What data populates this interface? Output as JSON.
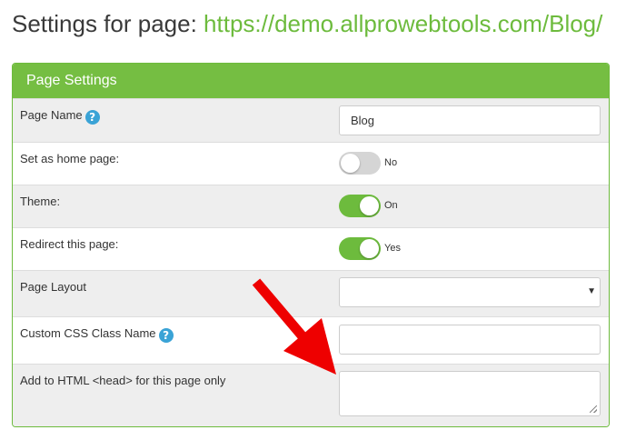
{
  "heading": {
    "prefix": "Settings for page: ",
    "url": "https://demo.allprowebtools.com/Blog/"
  },
  "panel": {
    "title": "Page Settings",
    "rows": [
      {
        "label": "Page Name",
        "value": "Blog"
      },
      {
        "label": "Set as home page:",
        "state": "No"
      },
      {
        "label": "Theme:",
        "state": "On"
      },
      {
        "label": "Redirect this page:",
        "state": "Yes"
      },
      {
        "label": "Page Layout",
        "selected": ""
      },
      {
        "label": "Custom CSS Class Name",
        "value": ""
      },
      {
        "label": "Add to HTML <head> for this page only",
        "value": ""
      }
    ]
  },
  "icons": {
    "help": "question-circle-icon",
    "arrow": "red-arrow-annotation"
  },
  "colors": {
    "accent_green": "#75be42",
    "link_green": "#6dbb3d",
    "help_blue": "#3aa3d6",
    "arrow_red": "#ee0000"
  }
}
